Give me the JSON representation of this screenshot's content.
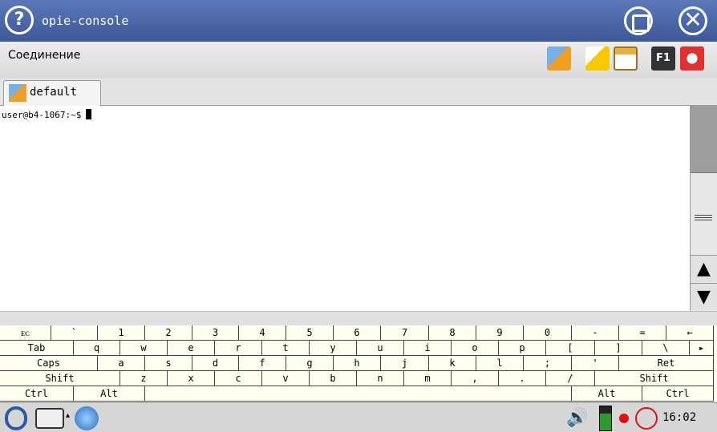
{
  "window": {
    "title": "opie-console",
    "help_glyph": "?",
    "close_glyph": "✕"
  },
  "menu": {
    "connection": "Соединение",
    "f1_label": "F1"
  },
  "tabs": [
    {
      "label": "default"
    }
  ],
  "terminal": {
    "prompt": "user@b4-1067:~$"
  },
  "scrollbar": {
    "up": "▲",
    "down": "▼"
  },
  "keyboard": {
    "rows": [
      [
        "ᴇᴄ",
        "`",
        "1",
        "2",
        "3",
        "4",
        "5",
        "6",
        "7",
        "8",
        "9",
        "0",
        "-",
        "=",
        "←"
      ],
      [
        "Tab",
        "q",
        "w",
        "e",
        "r",
        "t",
        "y",
        "u",
        "i",
        "o",
        "p",
        "[",
        "]",
        "\\",
        "▸"
      ],
      [
        "Caps",
        "a",
        "s",
        "d",
        "f",
        "g",
        "h",
        "j",
        "k",
        "l",
        ";",
        "'",
        "Ret"
      ],
      [
        "Shift",
        "z",
        "x",
        "c",
        "v",
        "b",
        "n",
        "m",
        ",",
        ".",
        "/",
        "Shift"
      ],
      [
        "Ctrl",
        "Alt",
        "",
        "Alt",
        "Ctrl"
      ]
    ]
  },
  "taskbar": {
    "clock": "16:02",
    "speaker_glyph": "🔊",
    "kbd_arrow": "▴"
  },
  "colors": {
    "titlebar": "#4a66a8",
    "keyboard_bg": "#fffff0",
    "record": "#e01010"
  }
}
